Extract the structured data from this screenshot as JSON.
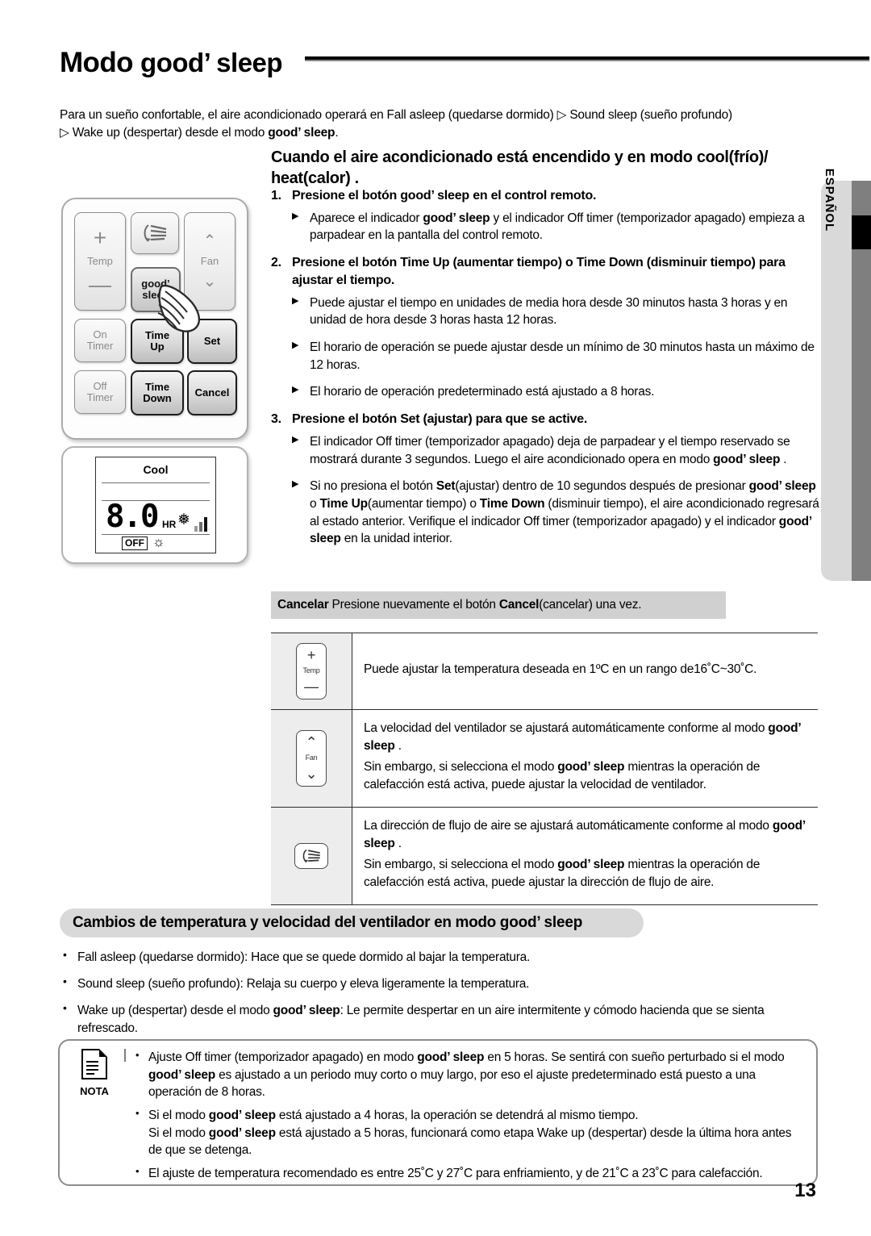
{
  "page": {
    "title_prefix": "Modo ",
    "title_brand": "good’ sleep",
    "page_number": "13",
    "language_tab": "ESPAÑOL"
  },
  "intro": {
    "line1": "Para un sueño confortable, el aire acondicionado operará en Fall asleep (quedarse dormido) ▷ Sound sleep (sueño profundo)",
    "line2_a": "▷ Wake up (despertar) desde el modo ",
    "line2_brand": "good’ sleep",
    "line2_b": "."
  },
  "section_heading": "Cuando el aire acondicionado está encendido y en modo cool(frío)/ heat(calor) .",
  "remote": {
    "buttons": {
      "temp_plus": "+",
      "temp_label": "Temp",
      "temp_minus": "—",
      "swing_icon": "swing-icon",
      "good_sleep_line1": "good’",
      "good_sleep_line2": "sleep",
      "fan_up": "⌃",
      "fan_label": "Fan",
      "fan_down": "⌄",
      "on_timer_l1": "On",
      "on_timer_l2": "Timer",
      "time_up_l1": "Time",
      "time_up_l2": "Up",
      "set": "Set",
      "off_timer_l1": "Off",
      "off_timer_l2": "Timer",
      "time_down_l1": "Time",
      "time_down_l2": "Down",
      "cancel": "Cancel"
    }
  },
  "lcd": {
    "mode": "Cool",
    "value": "8.0",
    "unit": "HR",
    "fan_icon": "fan-blade-icon",
    "fan_bars": 3,
    "off_badge": "OFF",
    "sleep_icon": "good-sleep-indicator-icon"
  },
  "steps": [
    {
      "num": "1.",
      "heading_a": "Presione el botón ",
      "heading_brand": "good’ sleep",
      "heading_b": " en el control remoto.",
      "subs": [
        {
          "parts": [
            {
              "t": "Aparece el indicador ",
              "b": false
            },
            {
              "t": "good’ sleep",
              "b": true
            },
            {
              "t": " y el indicador Off timer (temporizador apagado) empieza a parpadear en la pantalla del control remoto.",
              "b": false
            }
          ]
        }
      ]
    },
    {
      "num": "2.",
      "heading_a": "Presione el botón Time Up (aumentar tiempo) o Time Down (disminuir tiempo) para ajustar el tiempo.",
      "heading_brand": "",
      "heading_b": "",
      "subs": [
        {
          "parts": [
            {
              "t": "Puede ajustar el tiempo en unidades de media hora desde 30 minutos hasta 3 horas y en unidad de hora desde 3 horas hasta 12 horas.",
              "b": false
            }
          ]
        },
        {
          "parts": [
            {
              "t": "El horario de operación se puede ajustar desde un mínimo de 30 minutos hasta un máximo de 12 horas.",
              "b": false
            }
          ]
        },
        {
          "parts": [
            {
              "t": "El horario de operación predeterminado está ajustado a 8 horas.",
              "b": false
            }
          ]
        }
      ]
    },
    {
      "num": "3.",
      "heading_a": "Presione el botón Set (ajustar) para que se active.",
      "heading_brand": "",
      "heading_b": "",
      "subs": [
        {
          "parts": [
            {
              "t": "El indicador Off timer (temporizador apagado) deja de parpadear y el tiempo reservado se mostrará durante 3 segundos. Luego el aire acondicionado opera en modo ",
              "b": false
            },
            {
              "t": "good’ sleep",
              "b": true
            },
            {
              "t": " .",
              "b": false
            }
          ]
        },
        {
          "parts": [
            {
              "t": "Si no presiona el botón ",
              "b": false
            },
            {
              "t": "Set",
              "b": true
            },
            {
              "t": "(ajustar) dentro de 10 segundos después de presionar ",
              "b": false
            },
            {
              "t": "good’ sleep",
              "b": true
            },
            {
              "t": " o ",
              "b": false
            },
            {
              "t": "Time Up",
              "b": true
            },
            {
              "t": "(aumentar tiempo) o ",
              "b": false
            },
            {
              "t": "Time Down",
              "b": true
            },
            {
              "t": " (disminuir tiempo), el aire acondicionado regresará al estado anterior. Verifique el indicador Off timer (temporizador apagado) y el indicador ",
              "b": false
            },
            {
              "t": "good’ sleep",
              "b": true
            },
            {
              "t": " en la unidad interior.",
              "b": false
            }
          ]
        }
      ]
    }
  ],
  "cancel_bar": {
    "label": "Cancelar",
    "text_a": " Presione nuevamente el botón  ",
    "bold": "Cancel",
    "text_b": "(cancelar) una vez."
  },
  "feature_table": {
    "rows": [
      {
        "icon": "temp-button-icon",
        "icon_labels": {
          "plus": "+",
          "mid": "Temp",
          "minus": "—"
        },
        "paragraphs": [
          [
            {
              "t": "Puede ajustar la temperatura deseada en 1ºC en un rango de16˚C~30˚C.",
              "b": false
            }
          ]
        ]
      },
      {
        "icon": "fan-button-icon",
        "icon_labels": {
          "plus": "⌃",
          "mid": "Fan",
          "minus": "⌄"
        },
        "paragraphs": [
          [
            {
              "t": "La velocidad del ventilador se ajustará automáticamente conforme al modo ",
              "b": false
            },
            {
              "t": "good’ sleep",
              "b": true
            },
            {
              "t": " .",
              "b": false
            }
          ],
          [
            {
              "t": "Sin embargo, si selecciona el modo ",
              "b": false
            },
            {
              "t": "good’ sleep",
              "b": true
            },
            {
              "t": " mientras la operación de calefacción está activa, puede ajustar la velocidad de ventilador.",
              "b": false
            }
          ]
        ]
      },
      {
        "icon": "swing-button-icon",
        "icon_labels": {
          "plus": "",
          "mid": "",
          "minus": ""
        },
        "paragraphs": [
          [
            {
              "t": "La dirección de flujo de aire se ajustará automáticamente conforme al modo ",
              "b": false
            },
            {
              "t": "good’ sleep",
              "b": true
            },
            {
              "t": " .",
              "b": false
            }
          ],
          [
            {
              "t": "Sin embargo, si selecciona el modo ",
              "b": false
            },
            {
              "t": "good’ sleep",
              "b": true
            },
            {
              "t": " mientras la operación de calefacción está activa, puede ajustar la dirección de flujo de aire.",
              "b": false
            }
          ]
        ]
      }
    ]
  },
  "bottom_heading": {
    "text_a": "Cambios de temperatura y velocidad del ventilador en modo ",
    "brand": "good’ sleep"
  },
  "bottom_bullets": [
    [
      {
        "t": "Fall asleep (quedarse dormido): Hace que se quede dormido al bajar la temperatura.",
        "b": false
      }
    ],
    [
      {
        "t": "Sound sleep (sueño profundo): Relaja su cuerpo y eleva ligeramente la temperatura.",
        "b": false
      }
    ],
    [
      {
        "t": "Wake up (despertar) desde el modo ",
        "b": false
      },
      {
        "t": "good’ sleep",
        "b": true
      },
      {
        "t": ": Le permite despertar en un aire intermitente y cómodo hacienda que se sienta refrescado.",
        "b": false
      }
    ]
  ],
  "note": {
    "icon": "note-document-icon",
    "label": "NOTA",
    "bullets": [
      [
        {
          "t": "Ajuste Off timer (temporizador apagado) en modo ",
          "b": false
        },
        {
          "t": "good’ sleep",
          "b": true
        },
        {
          "t": " en 5 horas. Se sentirá con sueño perturbado si el modo ",
          "b": false
        },
        {
          "t": "good’ sleep",
          "b": true
        },
        {
          "t": " es ajustado a un periodo muy corto o muy largo, por eso el ajuste predeterminado está puesto a una operación de 8 horas.",
          "b": false
        }
      ],
      [
        {
          "t": "Si el modo ",
          "b": false
        },
        {
          "t": "good’ sleep",
          "b": true
        },
        {
          "t": " está ajustado a 4 horas, la operación se detendrá al mismo tiempo.",
          "b": false
        },
        {
          "t": "BR",
          "b": false
        },
        {
          "t": "Si el modo ",
          "b": false
        },
        {
          "t": "good’ sleep",
          "b": true
        },
        {
          "t": " está ajustado a 5 horas, funcionará como etapa Wake up (despertar) desde la última hora antes de que se detenga.",
          "b": false
        }
      ],
      [
        {
          "t": "El ajuste de temperatura recomendado es entre 25˚C y 27˚C para enfriamiento, y de 21˚C a 23˚C para calefacción.",
          "b": false
        }
      ]
    ]
  }
}
